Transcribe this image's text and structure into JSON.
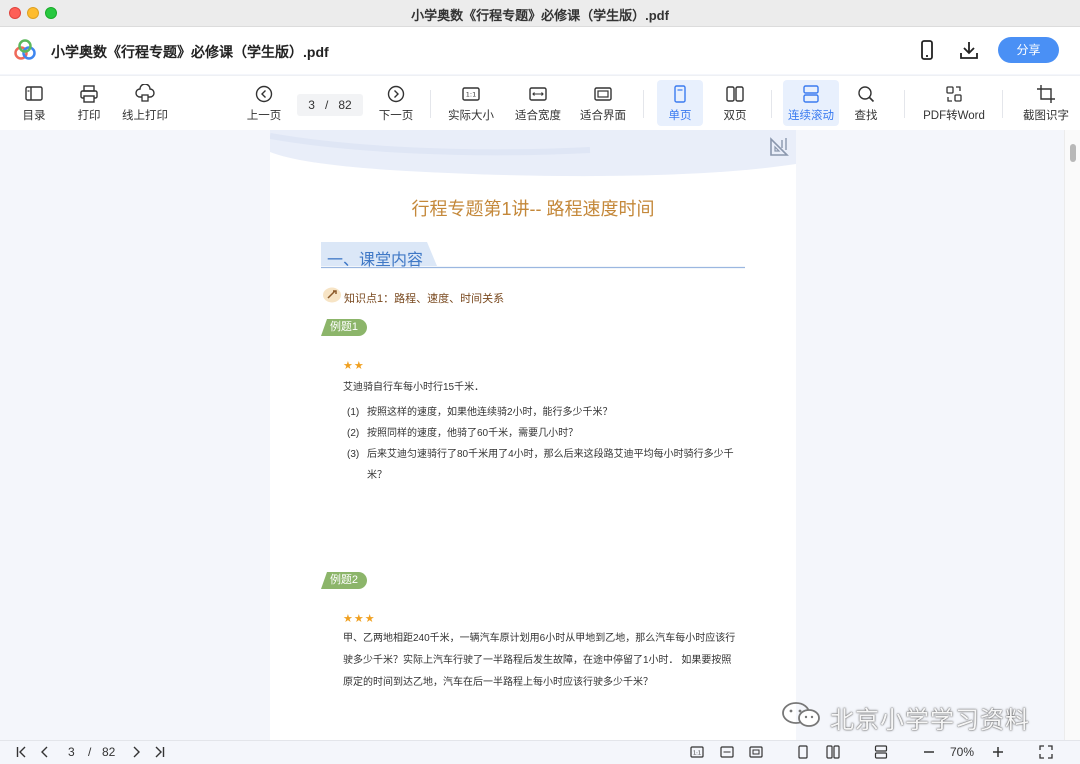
{
  "window": {
    "title": "小学奥数《行程专题》必修课（学生版）.pdf"
  },
  "header": {
    "doc_title": "小学奥数《行程专题》必修课（学生版）.pdf",
    "share_label": "分享"
  },
  "toolbar": {
    "toc": "目录",
    "print": "打印",
    "online_print": "线上打印",
    "prev_page": "上一页",
    "page_current": "3",
    "page_sep": "/",
    "page_total": "82",
    "next_page": "下一页",
    "actual_size": "实际大小",
    "fit_width": "适合宽度",
    "fit_screen": "适合界面",
    "single_page": "单页",
    "double_page": "双页",
    "continuous_scroll": "连续滚动",
    "find": "查找",
    "pdf_to_word": "PDF转Word",
    "ocr": "截图识字"
  },
  "content": {
    "lesson_title": "行程专题第1讲-- 路程速度时间",
    "section_title": "一、课堂内容",
    "knowledge_point": "知识点1：路程、速度、时间关系",
    "example1": {
      "tag": "例题1",
      "stars": "★★",
      "stem": "艾迪骑自行车每小时行15千米．",
      "items": [
        {
          "num": "(1)",
          "text": "按照这样的速度，如果他连续骑2小时，能行多少千米？"
        },
        {
          "num": "(2)",
          "text": "按照同样的速度，他骑了60千米，需要几小时？"
        },
        {
          "num": "(3)",
          "text": "后来艾迪匀速骑行了80千米用了4小时，那么后来这段路艾迪平均每小时骑行多少千",
          "cont": "米？"
        }
      ]
    },
    "example2": {
      "tag": "例题2",
      "stars": "★★★",
      "lines": [
        "甲、乙两地相距240千米，一辆汽车原计划用6小时从甲地到乙地，那么汽车每小时应该行",
        "驶多少千米？实际上汽车行驶了一半路程后发生故障，在途中停留了1小时． 如果要按照",
        "原定的时间到达乙地，汽车在后一半路程上每小时应该行驶多少千米？"
      ]
    }
  },
  "watermark": {
    "text": "北京小学学习资料"
  },
  "statusbar": {
    "page_current": "3",
    "page_sep": "/",
    "page_total": "82",
    "zoom": "70%"
  }
}
